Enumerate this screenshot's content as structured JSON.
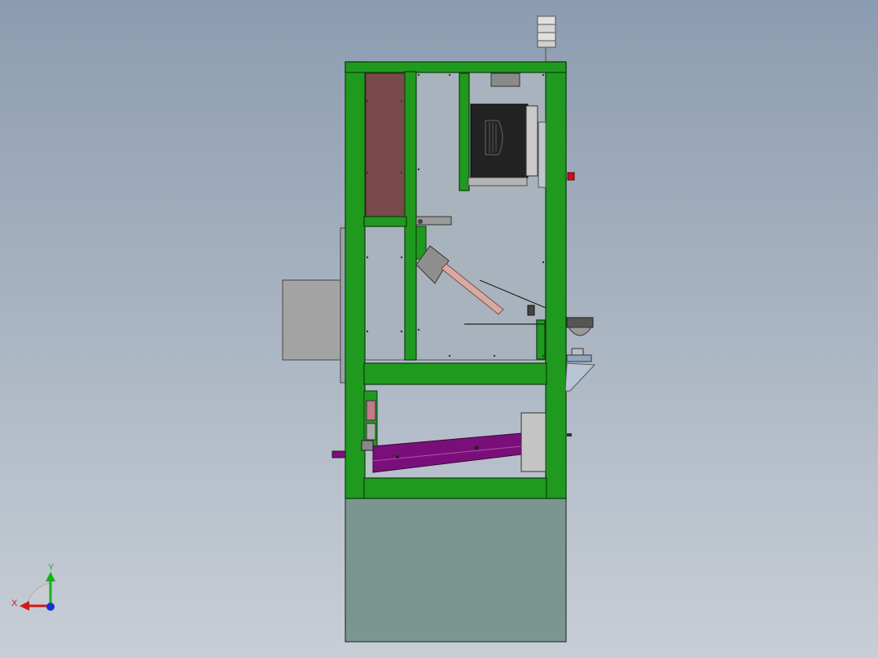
{
  "viewport": {
    "background_top": "#8c9cb0",
    "background_bottom": "#c8ced6"
  },
  "model": {
    "frame_color": "#1f9a1f",
    "frame_edge_color": "#0c3c0c",
    "panel_color": "#a9b3bd",
    "brown_panel_color": "#7a4a4a",
    "base_color": "#7a968f",
    "purple_part_color": "#7a0f7a",
    "motor_color": "#222222",
    "red_button_color": "#d01010"
  },
  "triad": {
    "label_x": "X",
    "label_y": "Y",
    "x_color": "#d01818",
    "y_color": "#18b018",
    "z_color": "#1830d0"
  }
}
